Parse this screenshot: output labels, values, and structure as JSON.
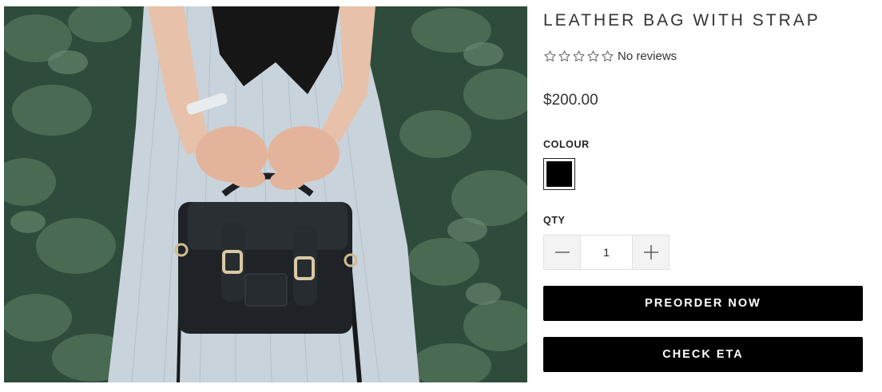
{
  "product": {
    "title": "LEATHER BAG WITH STRAP",
    "reviews_text": "No reviews",
    "rating_stars": 0,
    "rating_max": 5,
    "price": "$200.00",
    "image_icon": "product-photo-leather-bag"
  },
  "options": {
    "colour_label": "COLOUR",
    "swatch_color": "#000000",
    "qty_label": "QTY",
    "qty_value": "1"
  },
  "buttons": {
    "preorder_label": "PREORDER NOW",
    "check_eta_label": "CHECK ETA"
  }
}
